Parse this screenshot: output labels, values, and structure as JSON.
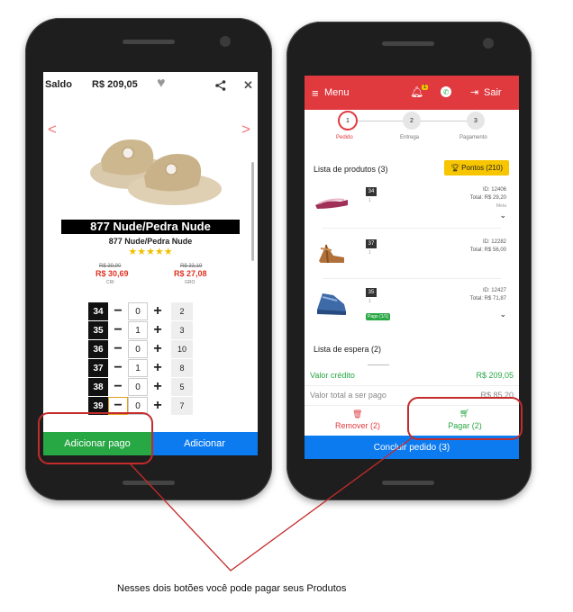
{
  "left_phone": {
    "balance_label": "Saldo",
    "balance_value": "R$ 209,05",
    "nav_prev": "<",
    "nav_next": ">",
    "product_title_banner": "877 Nude/Pedra Nude",
    "product_subtitle": "877 Nude/Pedra Nude",
    "stars": "★★★★★",
    "price_left_old": "R$ 39,90",
    "price_left": "R$ 30,69",
    "price_left_tag": "CRI",
    "price_right_old": "R$ 33,19",
    "price_right": "R$ 27,08",
    "price_right_tag": "GRO",
    "minus": "−",
    "plus": "+",
    "sizes": [
      {
        "size": "34",
        "qty": "0",
        "stock": "2"
      },
      {
        "size": "35",
        "qty": "1",
        "stock": "3"
      },
      {
        "size": "36",
        "qty": "0",
        "stock": "10"
      },
      {
        "size": "37",
        "qty": "1",
        "stock": "8"
      },
      {
        "size": "38",
        "qty": "0",
        "stock": "5"
      },
      {
        "size": "39",
        "qty": "0",
        "stock": "7"
      }
    ],
    "add_paid_button": "Adicionar pago",
    "add_button": "Adicionar"
  },
  "right_phone": {
    "menu_label": "Menu",
    "notification_count": "1",
    "exit_label": "Sair",
    "steps": [
      {
        "num": "1",
        "label": "Pedido"
      },
      {
        "num": "2",
        "label": "Entrega"
      },
      {
        "num": "3",
        "label": "Pagamento"
      }
    ],
    "products_header": "Lista de produtos (3)",
    "points_button": "Pontos (210)",
    "products": [
      {
        "size": "34",
        "qty": "1",
        "id": "ID: 12406",
        "total": "Total: R$ 29,20",
        "note": "Meta",
        "badge": ""
      },
      {
        "size": "37",
        "qty": "1",
        "id": "ID: 12282",
        "total": "Total: R$ 56,00",
        "note": "",
        "badge": ""
      },
      {
        "size": "35",
        "qty": "1",
        "id": "ID: 12427",
        "total": "Total: R$ 71,87",
        "note": "",
        "badge": "Pago (1/1)"
      }
    ],
    "waiting_header": "Lista de espera (2)",
    "credit_label": "Valor crédito",
    "credit_value": "R$ 209,05",
    "total_label": "Valor total a ser pago",
    "total_value": "R$ 85,20",
    "remove_button": "Remover (2)",
    "pay_button": "Pagar (2)",
    "finish_button": "Concluir pedido (3)"
  },
  "caption": "Nesses dois botões você pode pagar seus Produtos",
  "colors": {
    "accent_red": "#e0393e",
    "green": "#28a745",
    "blue": "#0d7bf0",
    "annotation_red": "#c42b2b"
  }
}
